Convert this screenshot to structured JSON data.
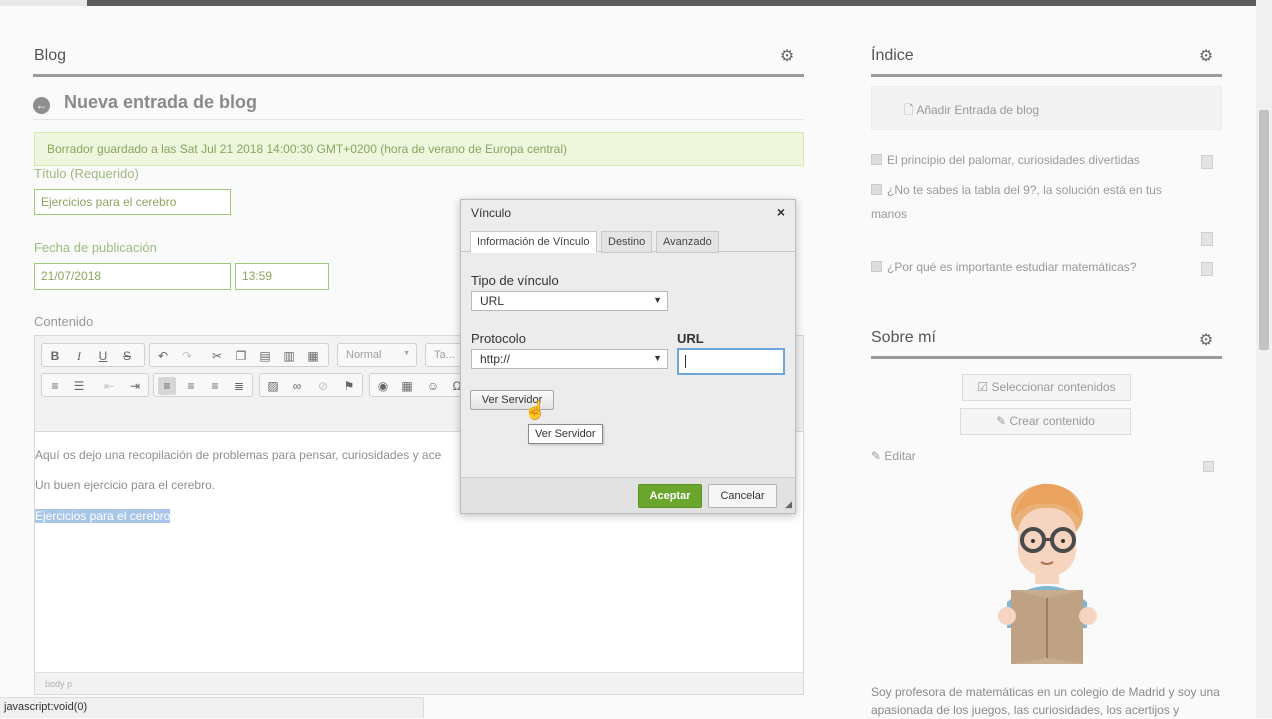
{
  "left_portlet": {
    "title": "Blog"
  },
  "entry": {
    "heading": "Nueva entrada de blog",
    "alert": "Borrador guardado a las Sat Jul 21 2018 14:00:30 GMT+0200 (hora de verano de Europa central)",
    "title_label": "Título (Requerido)",
    "title_value": "Ejercicios para el cerebro",
    "date_label": "Fecha de publicación",
    "date_value": "21/07/2018",
    "time_value": "13:59",
    "content_label": "Contenido"
  },
  "editor": {
    "format_combo": "Normal",
    "size_combo": "Ta...",
    "paragraphs": [
      "Aquí os dejo una recopilación de problemas para pensar, curiosidades y ace",
      "Un buen ejercicio para el cerebro.",
      "Ejercicios para el cerebro"
    ],
    "path": "body  p"
  },
  "dialog": {
    "title": "Vínculo",
    "tabs": [
      "Información de Vínculo",
      "Destino",
      "Avanzado"
    ],
    "link_type_label": "Tipo de vínculo",
    "link_type_value": "URL",
    "protocol_label": "Protocolo",
    "protocol_value": "http://",
    "url_label": "URL",
    "url_value": "",
    "browse_button": "Ver Servidor",
    "tooltip": "Ver Servidor",
    "ok_button": "Aceptar",
    "cancel_button": "Cancelar"
  },
  "index_portlet": {
    "title": "Índice",
    "add_link": "Añadir Entrada de blog",
    "items": [
      "El principio del palomar, curiosidades divertidas",
      "¿No te sabes la tabla del 9?, la solución está en tus manos",
      "¿Por qué es importante estudiar matemáticas?"
    ]
  },
  "about_portlet": {
    "title": "Sobre mí",
    "select_button": "Seleccionar contenidos",
    "create_button": "Crear contenido",
    "edit_link": "Editar",
    "text": "Soy profesora de matemáticas en un colegio de Madrid y soy una apasionada de los juegos, las curiosidades, los acertijos y"
  },
  "statusbar": {
    "text": "javascript:void(0)"
  },
  "colors": {
    "accent_green": "#6aa52c",
    "alert_bg": "#eef6de",
    "field_border": "#9fc97a"
  }
}
